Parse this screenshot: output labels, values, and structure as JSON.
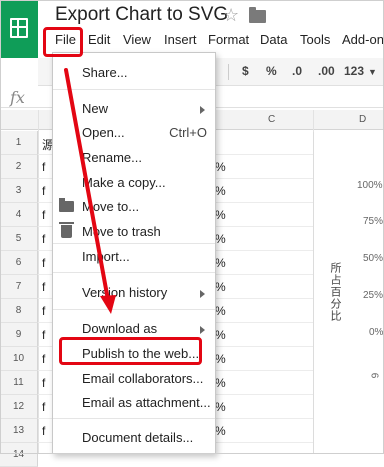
{
  "app": {
    "title": "Export Chart to SVG"
  },
  "menubar": [
    "File",
    "Edit",
    "View",
    "Insert",
    "Format",
    "Data",
    "Tools",
    "Add-on"
  ],
  "toolbar": {
    "currency": "$",
    "percent": "%",
    "decimal_less": ".0",
    "decimal_more": ".00",
    "more_formats": "123"
  },
  "formula_bar": {
    "fx_label": "fx"
  },
  "grid": {
    "columns": [
      "C",
      "D"
    ],
    "rows": [
      "1",
      "2",
      "3",
      "4",
      "5",
      "6",
      "7",
      "8",
      "9",
      "10",
      "11",
      "12",
      "13",
      "14"
    ],
    "col_b_cells": [
      "源",
      "f",
      "f",
      "f",
      "f",
      "f",
      "f",
      "f",
      "f",
      "f",
      "f",
      "f",
      "f"
    ],
    "pct_cells": [
      "%",
      "%",
      "%",
      "%",
      "%",
      "%",
      "%",
      "%",
      "%",
      "%",
      "%",
      "%"
    ]
  },
  "chart": {
    "y_ticks": [
      "100%",
      "75%",
      "50%",
      "25%",
      "0%"
    ],
    "y_label": "所占百分比",
    "extra_mark": "6"
  },
  "file_menu": {
    "items": [
      {
        "label": "Share..."
      },
      {
        "label": "New",
        "submenu": true
      },
      {
        "label": "Open...",
        "shortcut": "Ctrl+O"
      },
      {
        "label": "Rename..."
      },
      {
        "label": "Make a copy..."
      },
      {
        "label": "Move to...",
        "icon": "folder-icon"
      },
      {
        "label": "Move to trash",
        "icon": "trash-icon"
      },
      {
        "label": "Import..."
      },
      {
        "label": "Version history",
        "submenu": true
      },
      {
        "label": "Download as",
        "submenu": true
      },
      {
        "label": "Publish to the web...",
        "highlighted": true
      },
      {
        "label": "Email collaborators..."
      },
      {
        "label": "Email as attachment..."
      },
      {
        "label": "Document details..."
      }
    ]
  },
  "colors": {
    "brand": "#0f9d58",
    "annotation": "#e30613"
  }
}
